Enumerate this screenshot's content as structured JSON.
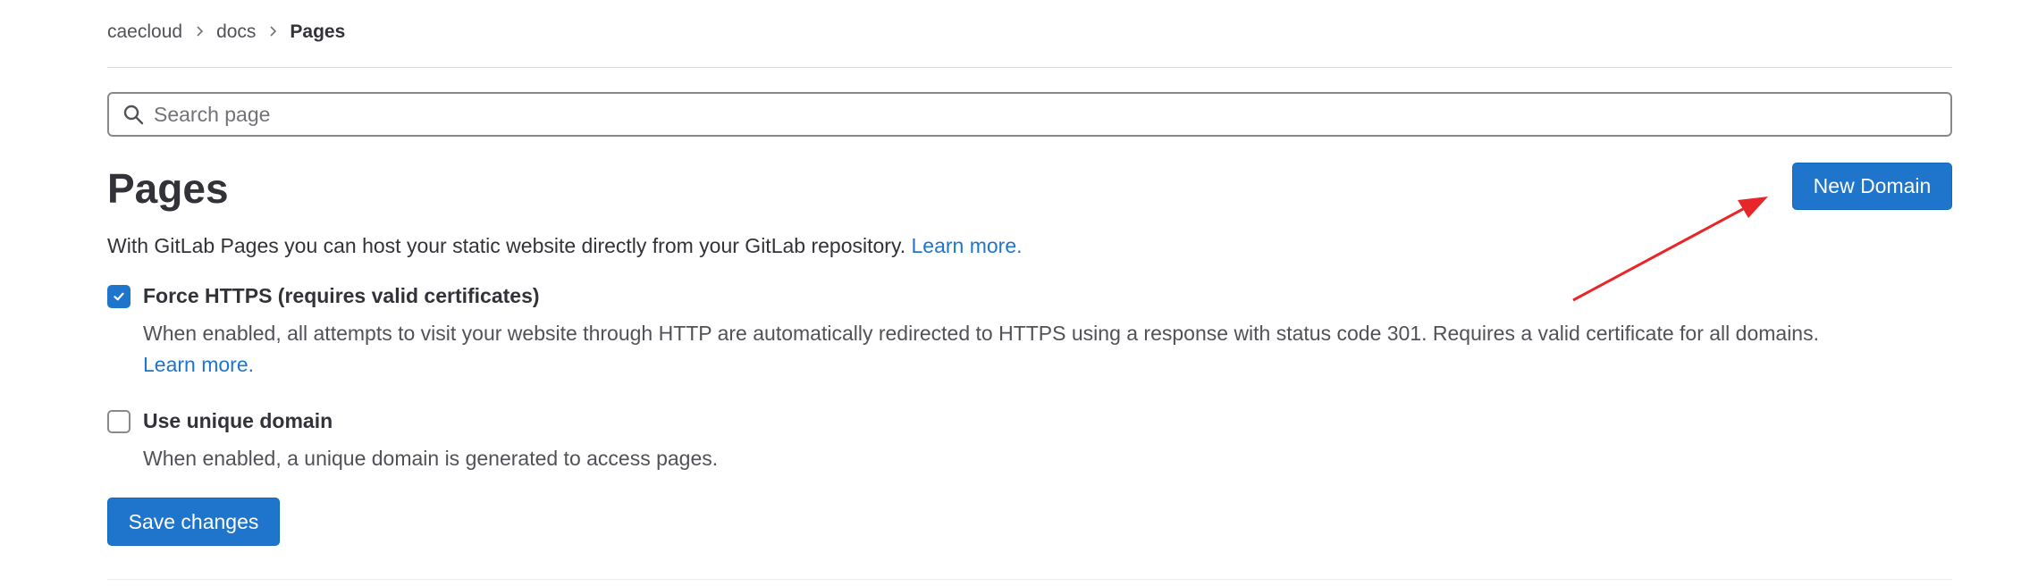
{
  "breadcrumb": {
    "items": [
      "caecloud",
      "docs"
    ],
    "current": "Pages"
  },
  "search": {
    "placeholder": "Search page",
    "value": ""
  },
  "header": {
    "title": "Pages",
    "new_domain_label": "New Domain"
  },
  "intro": {
    "text": "With GitLab Pages you can host your static website directly from your GitLab repository. ",
    "link": "Learn more."
  },
  "settings": {
    "force_https": {
      "label": "Force HTTPS (requires valid certificates)",
      "checked": true,
      "help": "When enabled, all attempts to visit your website through HTTP are automatically redirected to HTTPS using a response with status code 301. Requires a valid certificate for all domains.",
      "help_link": "Learn more."
    },
    "unique_domain": {
      "label": "Use unique domain",
      "checked": false,
      "help": "When enabled, a unique domain is generated to access pages."
    }
  },
  "actions": {
    "save_label": "Save changes"
  },
  "colors": {
    "primary": "#1f75cb",
    "text": "#333238",
    "annotation_arrow": "#e8262a"
  },
  "icons": {
    "search": "search-icon",
    "check": "check-icon",
    "chevron": "chevron-right-icon"
  }
}
